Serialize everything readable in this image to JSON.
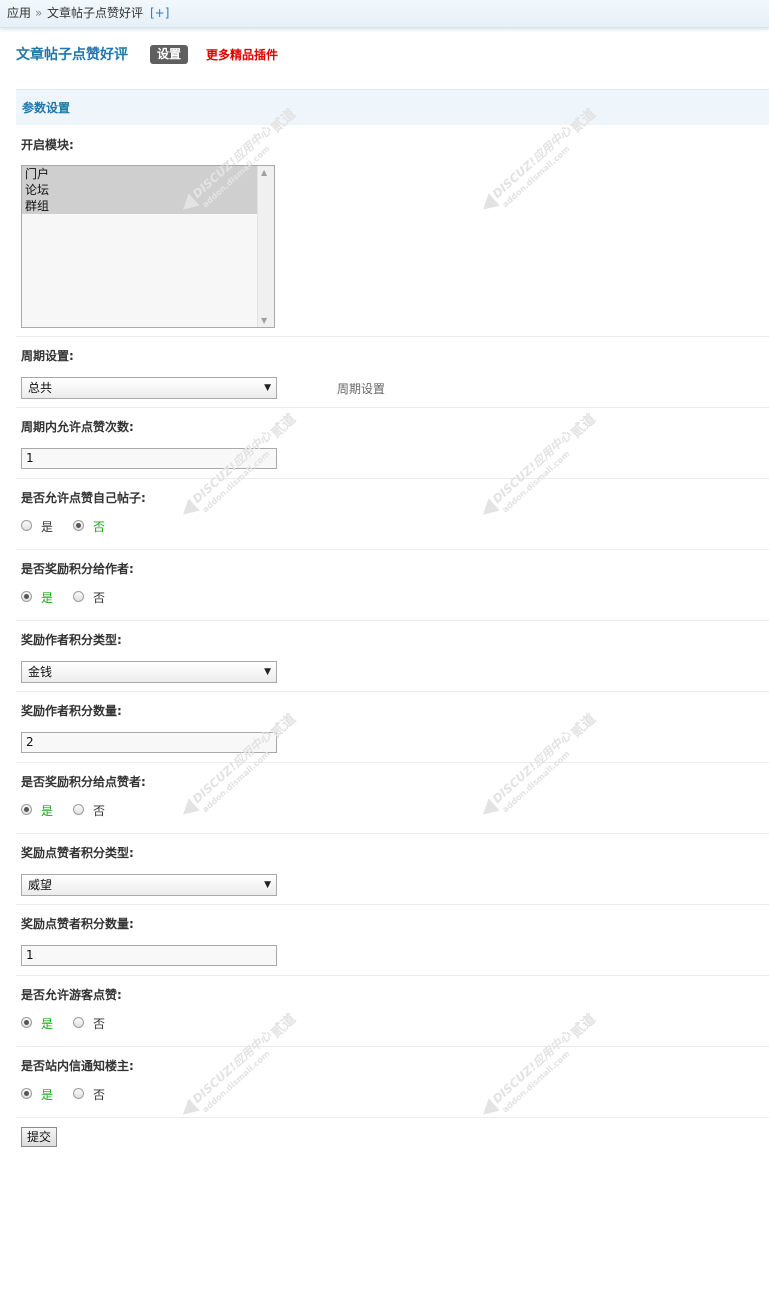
{
  "breadcrumb": {
    "root": "应用",
    "separator": "»",
    "current": "文章帖子点赞好评",
    "add": "[+]"
  },
  "header": {
    "title": "文章帖子点赞好评",
    "settings_button": "设置",
    "more_link": "更多精品插件"
  },
  "section": {
    "title": "参数设置"
  },
  "fields": {
    "modules": {
      "label": "开启模块:",
      "options": [
        "门户",
        "论坛",
        "群组"
      ]
    },
    "period": {
      "label": "周期设置:",
      "selected": "总共",
      "hint": "周期设置"
    },
    "likes_per_period": {
      "label": "周期内允许点赞次数:",
      "value": "1"
    },
    "like_own": {
      "label": "是否允许点赞自己帖子:",
      "yes": "是",
      "no": "否",
      "checked": "no"
    },
    "reward_author": {
      "label": "是否奖励积分给作者:",
      "yes": "是",
      "no": "否",
      "checked": "yes"
    },
    "author_credit_type": {
      "label": "奖励作者积分类型:",
      "selected": "金钱"
    },
    "author_credit_amount": {
      "label": "奖励作者积分数量:",
      "value": "2"
    },
    "reward_liker": {
      "label": "是否奖励积分给点赞者:",
      "yes": "是",
      "no": "否",
      "checked": "yes"
    },
    "liker_credit_type": {
      "label": "奖励点赞者积分类型:",
      "selected": "威望"
    },
    "liker_credit_amount": {
      "label": "奖励点赞者积分数量:",
      "value": "1"
    },
    "allow_guest": {
      "label": "是否允许游客点赞:",
      "yes": "是",
      "no": "否",
      "checked": "yes"
    },
    "notify_author": {
      "label": "是否站内信通知楼主:",
      "yes": "是",
      "no": "否",
      "checked": "yes"
    }
  },
  "submit_label": "提交",
  "watermark": {
    "brand": "DISCUZ!应用中心",
    "domain": "addon.dismall.com",
    "mark": "贰道",
    "color": "#e3e3e3"
  }
}
